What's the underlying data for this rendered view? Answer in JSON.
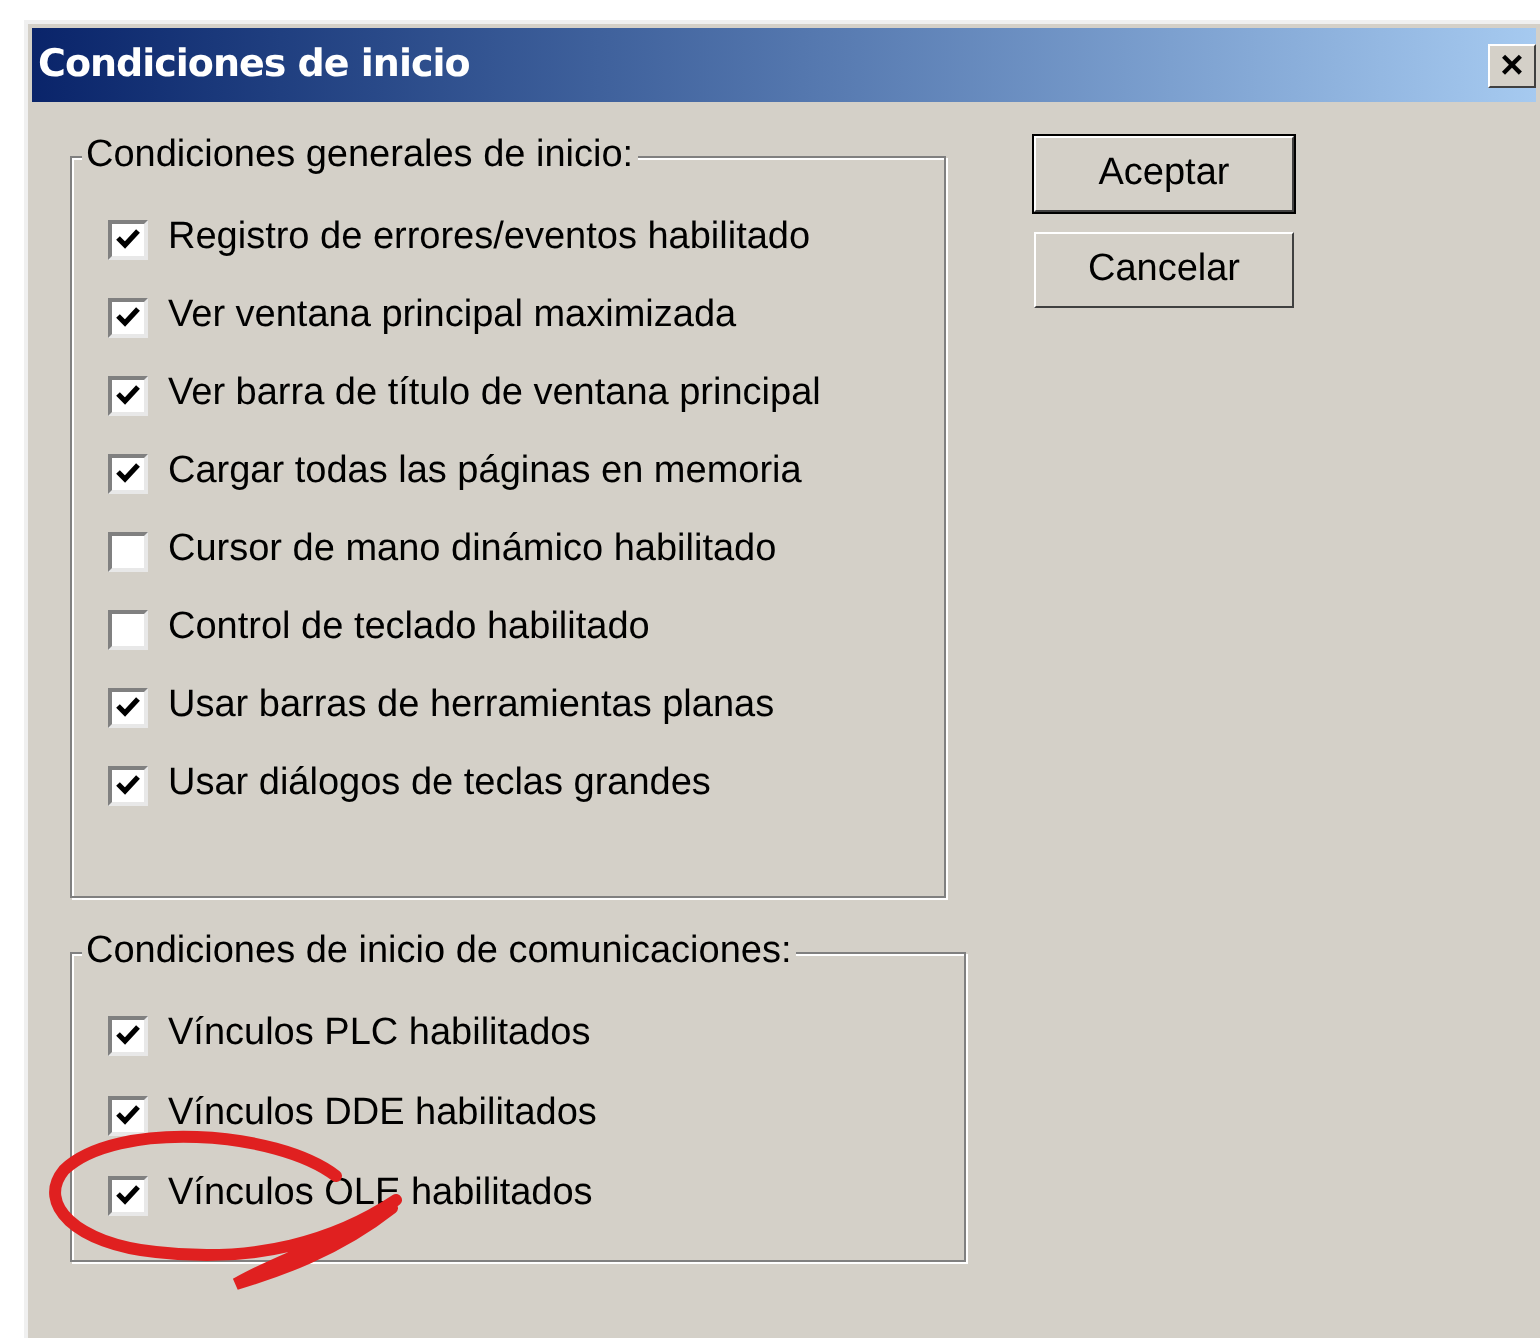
{
  "window": {
    "title": "Condiciones de inicio",
    "close": "×"
  },
  "groups": [
    {
      "legend": "Condiciones generales de inicio:",
      "items": [
        {
          "label": "Registro de errores/eventos habilitado",
          "checked": true
        },
        {
          "label": "Ver ventana principal maximizada",
          "checked": true
        },
        {
          "label": "Ver barra de título de ventana principal",
          "checked": true
        },
        {
          "label": "Cargar todas las páginas en memoria",
          "checked": true
        },
        {
          "label": "Cursor de mano dinámico habilitado",
          "checked": false
        },
        {
          "label": "Control de teclado habilitado",
          "checked": false
        },
        {
          "label": "Usar barras de herramientas planas",
          "checked": true
        },
        {
          "label": "Usar diálogos de teclas grandes",
          "checked": true
        }
      ]
    },
    {
      "legend": "Condiciones de inicio de comunicaciones:",
      "items": [
        {
          "label": "Vínculos PLC habilitados",
          "checked": true
        },
        {
          "label": "Vínculos DDE habilitados",
          "checked": true
        },
        {
          "label": "Vínculos OLE habilitados",
          "checked": true
        }
      ]
    }
  ],
  "buttons": [
    "Aceptar",
    "Cancelar"
  ]
}
